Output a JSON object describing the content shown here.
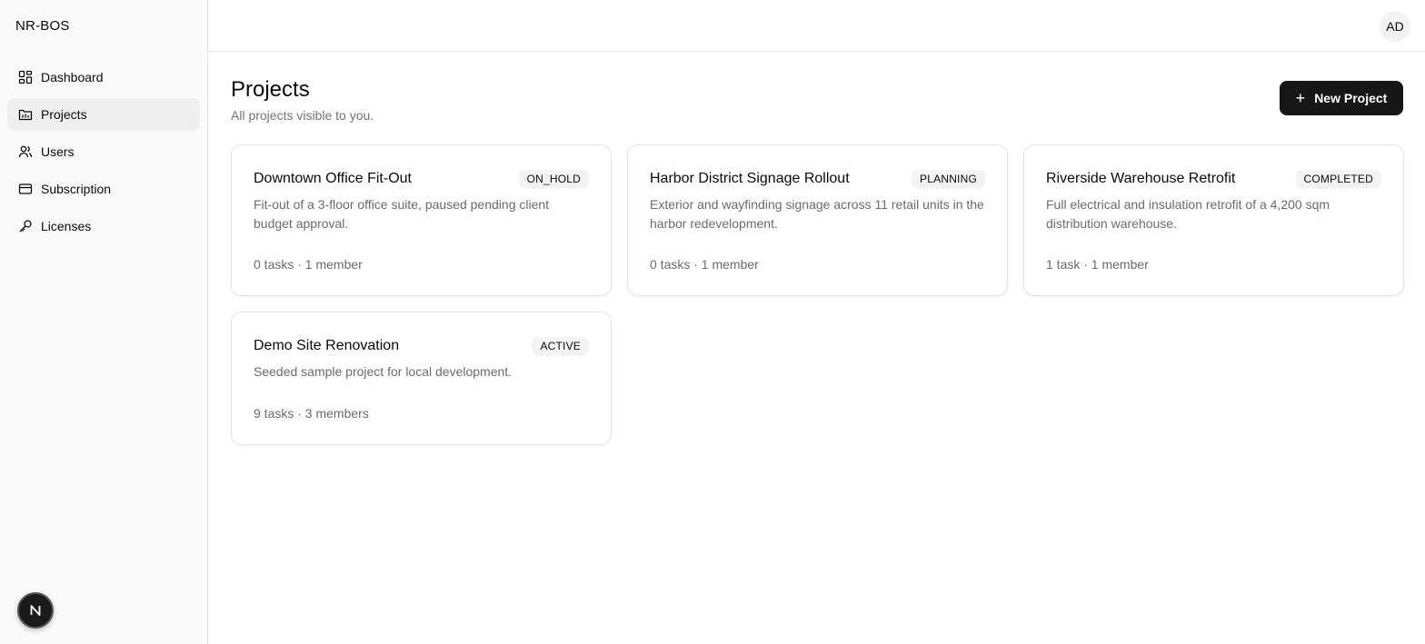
{
  "app": {
    "brand": "NR-BOS",
    "user_initials": "AD",
    "dev_badge": "N"
  },
  "sidebar": {
    "items": [
      {
        "label": "Dashboard",
        "icon": "dashboard-icon",
        "active": false
      },
      {
        "label": "Projects",
        "icon": "folder-icon",
        "active": true
      },
      {
        "label": "Users",
        "icon": "users-icon",
        "active": false
      },
      {
        "label": "Subscription",
        "icon": "credit-card-icon",
        "active": false
      },
      {
        "label": "Licenses",
        "icon": "key-icon",
        "active": false
      }
    ]
  },
  "page": {
    "title": "Projects",
    "subtitle": "All projects visible to you.",
    "new_button_label": "New Project"
  },
  "projects": [
    {
      "name": "Downtown Office Fit-Out",
      "status": "ON_HOLD",
      "description": "Fit-out of a 3-floor office suite, paused pending client budget approval.",
      "meta": "0 tasks · 1 member"
    },
    {
      "name": "Harbor District Signage Rollout",
      "status": "PLANNING",
      "description": "Exterior and wayfinding signage across 11 retail units in the harbor redevelopment.",
      "meta": "0 tasks · 1 member"
    },
    {
      "name": "Riverside Warehouse Retrofit",
      "status": "COMPLETED",
      "description": "Full electrical and insulation retrofit of a 4,200 sqm distribution warehouse.",
      "meta": "1 task · 1 member"
    },
    {
      "name": "Demo Site Renovation",
      "status": "ACTIVE",
      "description": "Seeded sample project for local development.",
      "meta": "9 tasks · 3 members"
    }
  ],
  "colors": {
    "primary_button": "#171717",
    "sidebar_bg": "#fafafa",
    "active_item_bg": "#efefef",
    "muted_text": "#737373"
  }
}
